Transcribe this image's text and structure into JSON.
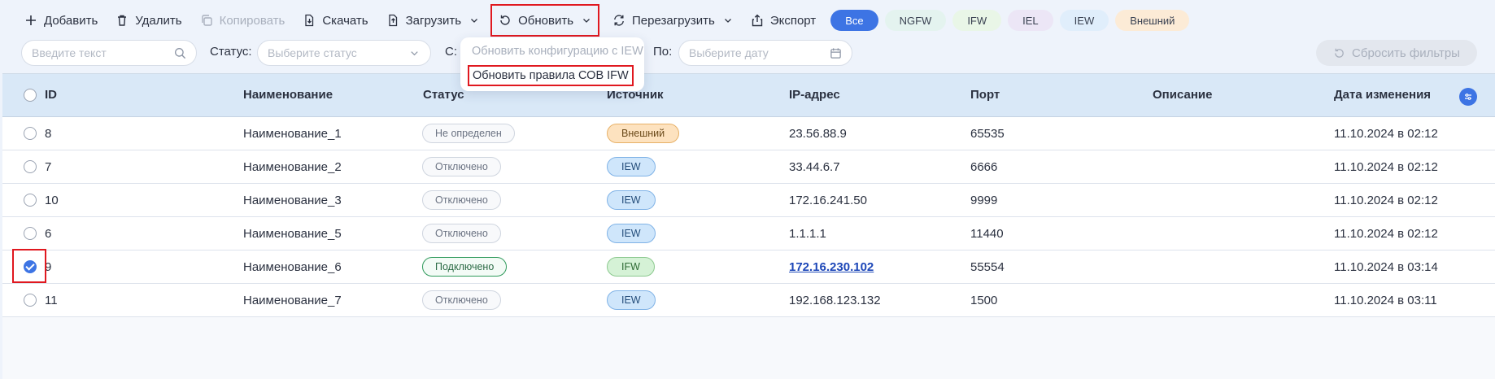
{
  "toolbar": {
    "add_label": "Добавить",
    "delete_label": "Удалить",
    "copy_label": "Копировать",
    "download_label": "Скачать",
    "upload_label": "Загрузить",
    "update_label": "Обновить",
    "reload_label": "Перезагрузить",
    "export_label": "Экспорт"
  },
  "chips": [
    {
      "label": "Все",
      "bg": "#3d74e4",
      "fg": "#ffffff",
      "active": true
    },
    {
      "label": "NGFW",
      "bg": "#e4f3ef",
      "fg": "#3a4252"
    },
    {
      "label": "IFW",
      "bg": "#e9f6e7",
      "fg": "#3a4252"
    },
    {
      "label": "IEL",
      "bg": "#ece6f6",
      "fg": "#3a4252"
    },
    {
      "label": "IEW",
      "bg": "#e0eefb",
      "fg": "#3a4252"
    },
    {
      "label": "Внешний",
      "bg": "#fcebd6",
      "fg": "#3a4252"
    }
  ],
  "filters": {
    "search_placeholder": "Введите текст",
    "status_label": "Статус:",
    "status_placeholder": "Выберите статус",
    "from_label": "С:",
    "to_label": "По:",
    "date_placeholder": "Выберите дату",
    "reset_label": "Сбросить фильтры"
  },
  "dropdown": {
    "items": [
      {
        "label": "Обновить конфигурацию с IEW",
        "disabled": true
      },
      {
        "label": "Обновить правила СОВ IFW",
        "disabled": false
      }
    ]
  },
  "table": {
    "columns": [
      "ID",
      "Наименование",
      "Статус",
      "Источник",
      "IP-адрес",
      "Порт",
      "Описание",
      "Дата изменения"
    ],
    "rows": [
      {
        "id": "8",
        "name": "Наименование_1",
        "status": "Не определен",
        "source": "Внешний",
        "ip": "23.56.88.9",
        "port": "65535",
        "description": "",
        "date": "11.10.2024 в 02:12",
        "checked": false
      },
      {
        "id": "7",
        "name": "Наименование_2",
        "status": "Отключено",
        "source": "IEW",
        "ip": "33.44.6.7",
        "port": "6666",
        "description": "",
        "date": "11.10.2024 в 02:12",
        "checked": false
      },
      {
        "id": "10",
        "name": "Наименование_3",
        "status": "Отключено",
        "source": "IEW",
        "ip": "172.16.241.50",
        "port": "9999",
        "description": "",
        "date": "11.10.2024 в 02:12",
        "checked": false
      },
      {
        "id": "6",
        "name": "Наименование_5",
        "status": "Отключено",
        "source": "IEW",
        "ip": "1.1.1.1",
        "port": "11440",
        "description": "",
        "date": "11.10.2024 в 02:12",
        "checked": false
      },
      {
        "id": "9",
        "name": "Наименование_6",
        "status": "Подключено",
        "source": "IFW",
        "ip": "172.16.230.102",
        "port": "55554",
        "description": "",
        "date": "11.10.2024 в 03:14",
        "checked": true
      },
      {
        "id": "11",
        "name": "Наименование_7",
        "status": "Отключено",
        "source": "IEW",
        "ip": "192.168.123.132",
        "port": "1500",
        "description": "",
        "date": "11.10.2024 в 03:11",
        "checked": false
      }
    ]
  },
  "source_colors": {
    "Внешний": {
      "bg": "#fde2bf",
      "border": "#e7b167",
      "fg": "#6b4a1a"
    },
    "IEW": {
      "bg": "#cfe6fb",
      "border": "#7fb2e6",
      "fg": "#244d7a"
    },
    "IFW": {
      "bg": "#d5f2d6",
      "border": "#8cc98f",
      "fg": "#2e6a34"
    }
  },
  "colors": {
    "accent": "#3d74e4",
    "highlight": "#e0181f",
    "connected": "#2f9a5b"
  }
}
